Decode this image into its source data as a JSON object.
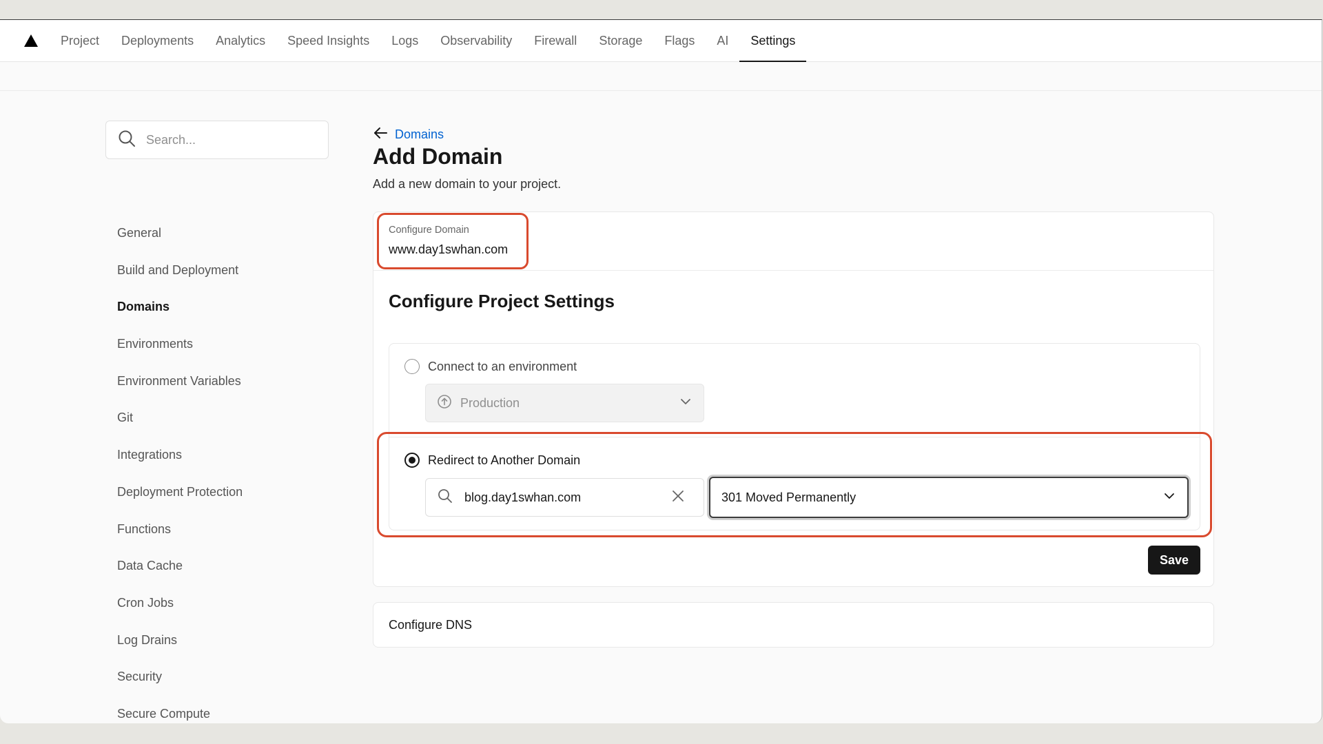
{
  "topnav": {
    "logo_icon": "triangle-logo-icon",
    "tabs": [
      {
        "label": "Project"
      },
      {
        "label": "Deployments"
      },
      {
        "label": "Analytics"
      },
      {
        "label": "Speed Insights"
      },
      {
        "label": "Logs"
      },
      {
        "label": "Observability"
      },
      {
        "label": "Firewall"
      },
      {
        "label": "Storage"
      },
      {
        "label": "Flags"
      },
      {
        "label": "AI"
      },
      {
        "label": "Settings",
        "active": true
      }
    ]
  },
  "sidebar": {
    "search_placeholder": "Search...",
    "items": [
      {
        "label": "General"
      },
      {
        "label": "Build and Deployment"
      },
      {
        "label": "Domains",
        "active": true
      },
      {
        "label": "Environments"
      },
      {
        "label": "Environment Variables"
      },
      {
        "label": "Git"
      },
      {
        "label": "Integrations"
      },
      {
        "label": "Deployment Protection"
      },
      {
        "label": "Functions"
      },
      {
        "label": "Data Cache"
      },
      {
        "label": "Cron Jobs"
      },
      {
        "label": "Log Drains"
      },
      {
        "label": "Security"
      },
      {
        "label": "Secure Compute"
      }
    ]
  },
  "main": {
    "back_label": "Domains",
    "title": "Add Domain",
    "description": "Add a new domain to your project.",
    "configure_domain_label": "Configure Domain",
    "configure_domain_value": "www.day1swhan.com",
    "section_title": "Configure Project Settings",
    "option_environment": {
      "label": "Connect to an environment",
      "selected": false,
      "select_value": "Production"
    },
    "option_redirect": {
      "label": "Redirect to Another Domain",
      "selected": true,
      "input_value": "blog.day1swhan.com",
      "status_value": "301 Moved Permanently"
    },
    "save_label": "Save",
    "dns_label": "Configure DNS"
  },
  "colors": {
    "accent_link": "#0062d1",
    "highlight": "#d94a2e",
    "primary_button": "#171717"
  }
}
